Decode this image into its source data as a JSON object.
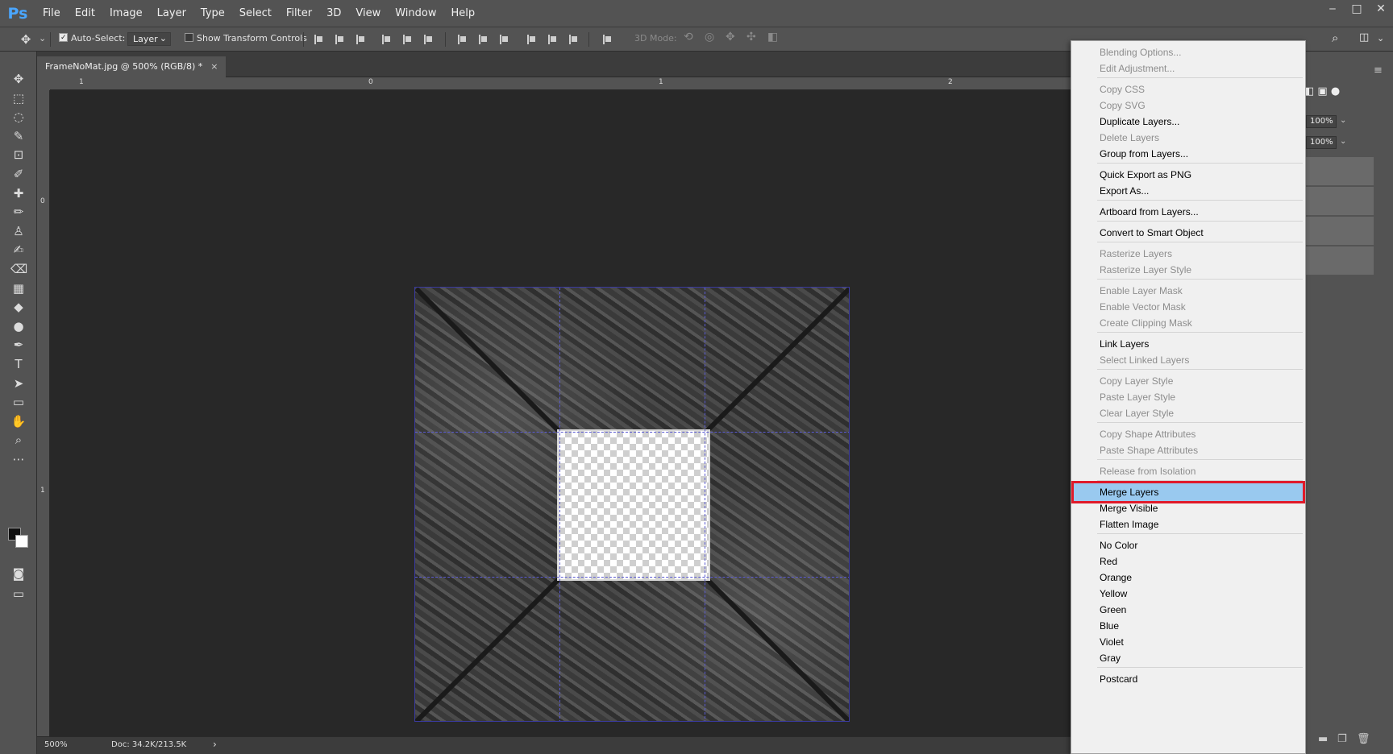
{
  "app": {
    "logo": "Ps"
  },
  "menubar": {
    "items": [
      "File",
      "Edit",
      "Image",
      "Layer",
      "Type",
      "Select",
      "Filter",
      "3D",
      "View",
      "Window",
      "Help"
    ]
  },
  "window_controls": {
    "minimize": "‒",
    "maximize": "□",
    "close": "✕"
  },
  "options": {
    "auto_select_label": "Auto-Select:",
    "auto_select_checked": true,
    "auto_select_target": "Layer",
    "show_transform_label": "Show Transform Controls",
    "show_transform_checked": false,
    "mode_3d_label": "3D Mode:"
  },
  "document": {
    "tab_title": "FrameNoMat.jpg @ 500% (RGB/8) *",
    "close": "×"
  },
  "rulers": {
    "top_labels": [
      "1",
      "0",
      "1",
      "2"
    ],
    "left_labels": [
      "0",
      "1"
    ]
  },
  "statusbar": {
    "zoom": "500%",
    "doc_info": "Doc: 34.2K/213.5K",
    "arrow": "›"
  },
  "panels": {
    "opacity": "100%",
    "fill": "100%"
  },
  "context_menu": {
    "groups": [
      [
        {
          "label": "Blending Options...",
          "enabled": false
        },
        {
          "label": "Edit Adjustment...",
          "enabled": false
        }
      ],
      [
        {
          "label": "Copy CSS",
          "enabled": false
        },
        {
          "label": "Copy SVG",
          "enabled": false
        },
        {
          "label": "Duplicate Layers...",
          "enabled": true
        },
        {
          "label": "Delete Layers",
          "enabled": false
        },
        {
          "label": "Group from Layers...",
          "enabled": true
        }
      ],
      [
        {
          "label": "Quick Export as PNG",
          "enabled": true
        },
        {
          "label": "Export As...",
          "enabled": true
        }
      ],
      [
        {
          "label": "Artboard from Layers...",
          "enabled": true
        }
      ],
      [
        {
          "label": "Convert to Smart Object",
          "enabled": true
        }
      ],
      [
        {
          "label": "Rasterize Layers",
          "enabled": false
        },
        {
          "label": "Rasterize Layer Style",
          "enabled": false
        }
      ],
      [
        {
          "label": "Enable Layer Mask",
          "enabled": false
        },
        {
          "label": "Enable Vector Mask",
          "enabled": false
        },
        {
          "label": "Create Clipping Mask",
          "enabled": false
        }
      ],
      [
        {
          "label": "Link Layers",
          "enabled": true
        },
        {
          "label": "Select Linked Layers",
          "enabled": false
        }
      ],
      [
        {
          "label": "Copy Layer Style",
          "enabled": false
        },
        {
          "label": "Paste Layer Style",
          "enabled": false
        },
        {
          "label": "Clear Layer Style",
          "enabled": false
        }
      ],
      [
        {
          "label": "Copy Shape Attributes",
          "enabled": false
        },
        {
          "label": "Paste Shape Attributes",
          "enabled": false
        }
      ],
      [
        {
          "label": "Release from Isolation",
          "enabled": false
        }
      ],
      [
        {
          "label": "Merge Layers",
          "enabled": true,
          "highlighted": true
        },
        {
          "label": "Merge Visible",
          "enabled": true
        },
        {
          "label": "Flatten Image",
          "enabled": true
        }
      ],
      [
        {
          "label": "No Color",
          "enabled": true
        },
        {
          "label": "Red",
          "enabled": true
        },
        {
          "label": "Orange",
          "enabled": true
        },
        {
          "label": "Yellow",
          "enabled": true
        },
        {
          "label": "Green",
          "enabled": true
        },
        {
          "label": "Blue",
          "enabled": true
        },
        {
          "label": "Violet",
          "enabled": true
        },
        {
          "label": "Gray",
          "enabled": true
        }
      ],
      [
        {
          "label": "Postcard",
          "enabled": true
        }
      ]
    ],
    "highlight_color": "#99c9ef",
    "annotation_color": "#e01a2a"
  },
  "tools": [
    "move-tool-icon",
    "marquee-tool-icon",
    "lasso-tool-icon",
    "quick-select-tool-icon",
    "crop-tool-icon",
    "eyedropper-tool-icon",
    "healing-brush-tool-icon",
    "brush-tool-icon",
    "clone-stamp-tool-icon",
    "history-brush-tool-icon",
    "eraser-tool-icon",
    "gradient-tool-icon",
    "blur-tool-icon",
    "dodge-tool-icon",
    "pen-tool-icon",
    "type-tool-icon",
    "path-select-tool-icon",
    "rectangle-tool-icon",
    "hand-tool-icon",
    "zoom-tool-icon",
    "more-tools-icon"
  ]
}
